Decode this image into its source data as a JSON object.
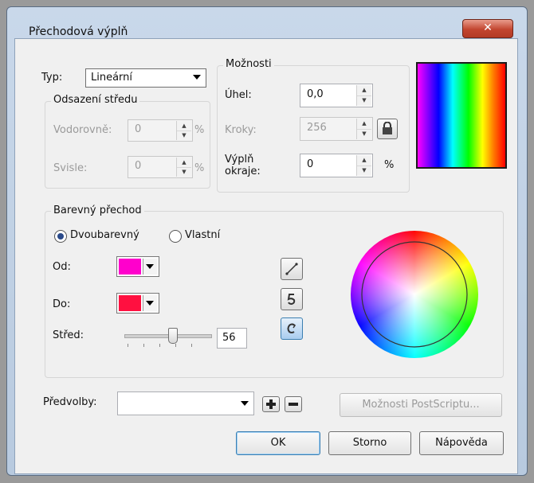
{
  "window": {
    "title": "Přechodová výplň",
    "close_glyph": "✕"
  },
  "fill_type": {
    "label": "Typ:",
    "value": "Lineární"
  },
  "center_offset": {
    "legend": "Odsazení středu",
    "horizontal_label": "Vodorovně:",
    "horizontal_value": "0",
    "vertical_label": "Svisle:",
    "vertical_value": "0",
    "unit": "%"
  },
  "options": {
    "legend": "Možnosti",
    "angle_label": "Úhel:",
    "angle_value": "0,0",
    "steps_label": "Kroky:",
    "steps_value": "256",
    "edge_pad_label_1": "Výplň",
    "edge_pad_label_2": "okraje:",
    "edge_pad_value": "0",
    "edge_pad_unit": "%"
  },
  "color_blend": {
    "legend": "Barevný přechod",
    "two_color_label": "Dvoubarevný",
    "custom_label": "Vlastní",
    "selected": "two_color",
    "from_label": "Od:",
    "from_color": "#ff00cc",
    "to_label": "Do:",
    "to_color": "#ff1040",
    "midpoint_label": "Střed:",
    "midpoint_value": "56",
    "midpoint_fraction": 0.56
  },
  "presets": {
    "label": "Předvolby:",
    "value": ""
  },
  "buttons": {
    "postscript": "Možnosti PostScriptu...",
    "ok": "OK",
    "cancel": "Storno",
    "help": "Nápověda"
  },
  "icons": {
    "lock": "lock-icon",
    "direct_path": "direct-path-icon",
    "ccw_path": "counterclockwise-path-icon",
    "cw_path": "clockwise-path-icon",
    "add": "plus-icon",
    "remove": "minus-icon"
  }
}
